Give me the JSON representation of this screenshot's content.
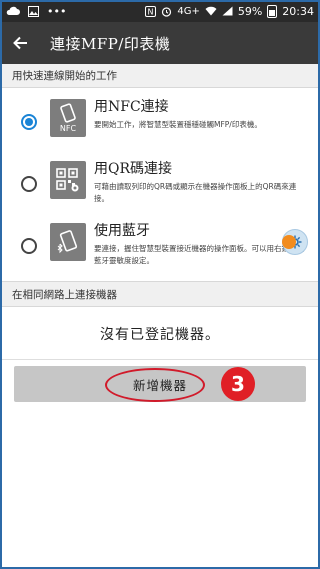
{
  "status_bar": {
    "left_icons": [
      "cloud-icon",
      "image-icon",
      "more-dots-icon"
    ],
    "right_icons": [
      "nfc-icon",
      "alarm-icon",
      "wifi-icon",
      "signal-icon",
      "battery-icon"
    ],
    "network_label": "4G+",
    "battery_percent": "59%",
    "time": "20:34"
  },
  "app_bar": {
    "back_icon": "back-arrow-icon",
    "title": "連接MFP/印表機"
  },
  "section_quick": {
    "title": "用快速連線開始的工作"
  },
  "options": [
    {
      "title": "用NFC連接",
      "description": "要開始工作，將智慧型裝置穩穩碰觸MFP/印表機。",
      "icon": "nfc-phone-icon",
      "icon_label": "NFC",
      "selected": true
    },
    {
      "title": "用QR碼連接",
      "description": "可藉由讀取列印的QR碼或顯示在機器操作面板上的QR碼來連接。",
      "icon": "qr-code-icon",
      "selected": false
    },
    {
      "title": "使用藍牙",
      "description": "要連接，握住智慧型裝置接近機器的操作面板。可以用右鈕變更藍牙靈敏度設定。",
      "icon": "bluetooth-phone-icon",
      "selected": false
    }
  ],
  "section_network": {
    "title": "在相同網路上連接機器"
  },
  "device_list": {
    "empty_message": "沒有已登記機器。"
  },
  "add_button": {
    "label": "新增機器"
  },
  "annotation": {
    "step_number": "3",
    "highlight_color": "#d11a2a",
    "badge_color": "#e01f26"
  },
  "colors": {
    "accent": "#1a84d6",
    "app_bar": "#3a3a3a",
    "status_bar": "#2a2a2a",
    "floating_dot": "#f28c1e"
  }
}
